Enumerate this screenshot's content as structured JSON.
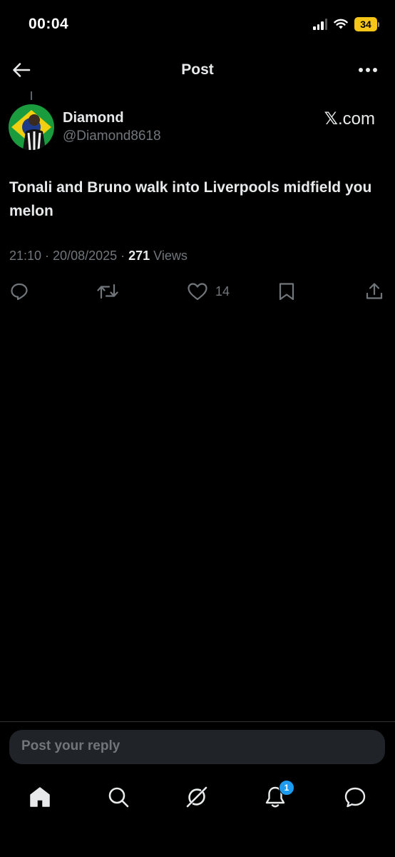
{
  "status_bar": {
    "time": "00:04",
    "battery_level": "34",
    "signal_bars": 3,
    "battery_color": "#f5c518"
  },
  "header": {
    "title": "Post",
    "back_icon": "arrow-left-icon",
    "more_icon": "more-horizontal-icon"
  },
  "post": {
    "author": {
      "display_name": "Diamond",
      "handle": "@Diamond8618"
    },
    "source_badge": {
      "logo": "𝕏",
      "suffix": ".com"
    },
    "text": "Tonali and Bruno walk into Liverpools midfield you melon",
    "timestamp": "21:10 · 20/08/2025 · ",
    "views_count": "271",
    "views_label": " Views",
    "actions": {
      "reply_icon": "reply-icon",
      "repost_icon": "repost-icon",
      "like_icon": "heart-icon",
      "like_count": "14",
      "bookmark_icon": "bookmark-icon",
      "share_icon": "share-icon"
    }
  },
  "reply_box": {
    "placeholder": "Post your reply"
  },
  "tab_bar": {
    "items": [
      {
        "name": "home",
        "icon": "home-icon"
      },
      {
        "name": "search",
        "icon": "search-icon"
      },
      {
        "name": "grok",
        "icon": "grok-icon"
      },
      {
        "name": "notifications",
        "icon": "bell-icon",
        "badge": "1"
      },
      {
        "name": "messages",
        "icon": "chat-bubble-icon"
      }
    ]
  },
  "colors": {
    "background": "#000000",
    "text_primary": "#e7e9ea",
    "text_secondary": "#71767b",
    "accent": "#1d9bf0"
  }
}
